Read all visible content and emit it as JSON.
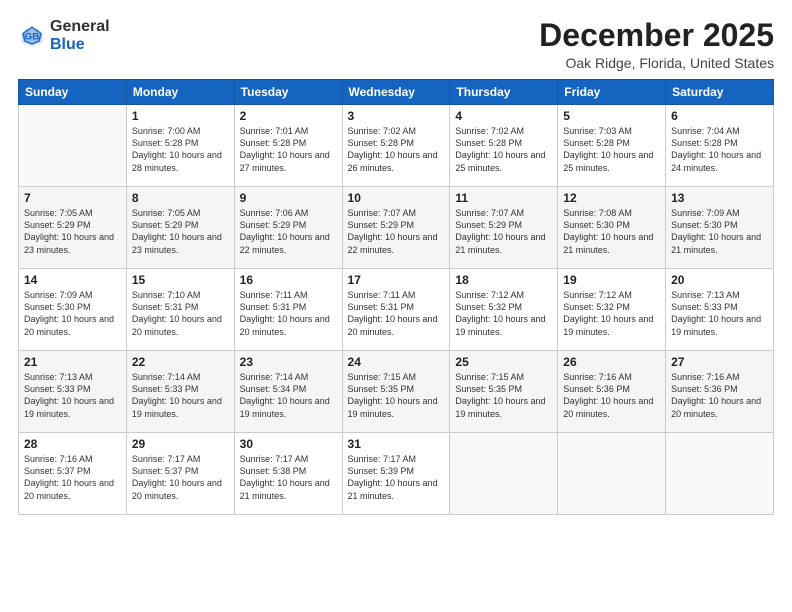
{
  "header": {
    "logo_general": "General",
    "logo_blue": "Blue",
    "month_title": "December 2025",
    "location": "Oak Ridge, Florida, United States"
  },
  "weekdays": [
    "Sunday",
    "Monday",
    "Tuesday",
    "Wednesday",
    "Thursday",
    "Friday",
    "Saturday"
  ],
  "weeks": [
    [
      {
        "day": "",
        "sunrise": "",
        "sunset": "",
        "daylight": ""
      },
      {
        "day": "1",
        "sunrise": "Sunrise: 7:00 AM",
        "sunset": "Sunset: 5:28 PM",
        "daylight": "Daylight: 10 hours and 28 minutes."
      },
      {
        "day": "2",
        "sunrise": "Sunrise: 7:01 AM",
        "sunset": "Sunset: 5:28 PM",
        "daylight": "Daylight: 10 hours and 27 minutes."
      },
      {
        "day": "3",
        "sunrise": "Sunrise: 7:02 AM",
        "sunset": "Sunset: 5:28 PM",
        "daylight": "Daylight: 10 hours and 26 minutes."
      },
      {
        "day": "4",
        "sunrise": "Sunrise: 7:02 AM",
        "sunset": "Sunset: 5:28 PM",
        "daylight": "Daylight: 10 hours and 25 minutes."
      },
      {
        "day": "5",
        "sunrise": "Sunrise: 7:03 AM",
        "sunset": "Sunset: 5:28 PM",
        "daylight": "Daylight: 10 hours and 25 minutes."
      },
      {
        "day": "6",
        "sunrise": "Sunrise: 7:04 AM",
        "sunset": "Sunset: 5:28 PM",
        "daylight": "Daylight: 10 hours and 24 minutes."
      }
    ],
    [
      {
        "day": "7",
        "sunrise": "Sunrise: 7:05 AM",
        "sunset": "Sunset: 5:29 PM",
        "daylight": "Daylight: 10 hours and 23 minutes."
      },
      {
        "day": "8",
        "sunrise": "Sunrise: 7:05 AM",
        "sunset": "Sunset: 5:29 PM",
        "daylight": "Daylight: 10 hours and 23 minutes."
      },
      {
        "day": "9",
        "sunrise": "Sunrise: 7:06 AM",
        "sunset": "Sunset: 5:29 PM",
        "daylight": "Daylight: 10 hours and 22 minutes."
      },
      {
        "day": "10",
        "sunrise": "Sunrise: 7:07 AM",
        "sunset": "Sunset: 5:29 PM",
        "daylight": "Daylight: 10 hours and 22 minutes."
      },
      {
        "day": "11",
        "sunrise": "Sunrise: 7:07 AM",
        "sunset": "Sunset: 5:29 PM",
        "daylight": "Daylight: 10 hours and 21 minutes."
      },
      {
        "day": "12",
        "sunrise": "Sunrise: 7:08 AM",
        "sunset": "Sunset: 5:30 PM",
        "daylight": "Daylight: 10 hours and 21 minutes."
      },
      {
        "day": "13",
        "sunrise": "Sunrise: 7:09 AM",
        "sunset": "Sunset: 5:30 PM",
        "daylight": "Daylight: 10 hours and 21 minutes."
      }
    ],
    [
      {
        "day": "14",
        "sunrise": "Sunrise: 7:09 AM",
        "sunset": "Sunset: 5:30 PM",
        "daylight": "Daylight: 10 hours and 20 minutes."
      },
      {
        "day": "15",
        "sunrise": "Sunrise: 7:10 AM",
        "sunset": "Sunset: 5:31 PM",
        "daylight": "Daylight: 10 hours and 20 minutes."
      },
      {
        "day": "16",
        "sunrise": "Sunrise: 7:11 AM",
        "sunset": "Sunset: 5:31 PM",
        "daylight": "Daylight: 10 hours and 20 minutes."
      },
      {
        "day": "17",
        "sunrise": "Sunrise: 7:11 AM",
        "sunset": "Sunset: 5:31 PM",
        "daylight": "Daylight: 10 hours and 20 minutes."
      },
      {
        "day": "18",
        "sunrise": "Sunrise: 7:12 AM",
        "sunset": "Sunset: 5:32 PM",
        "daylight": "Daylight: 10 hours and 19 minutes."
      },
      {
        "day": "19",
        "sunrise": "Sunrise: 7:12 AM",
        "sunset": "Sunset: 5:32 PM",
        "daylight": "Daylight: 10 hours and 19 minutes."
      },
      {
        "day": "20",
        "sunrise": "Sunrise: 7:13 AM",
        "sunset": "Sunset: 5:33 PM",
        "daylight": "Daylight: 10 hours and 19 minutes."
      }
    ],
    [
      {
        "day": "21",
        "sunrise": "Sunrise: 7:13 AM",
        "sunset": "Sunset: 5:33 PM",
        "daylight": "Daylight: 10 hours and 19 minutes."
      },
      {
        "day": "22",
        "sunrise": "Sunrise: 7:14 AM",
        "sunset": "Sunset: 5:33 PM",
        "daylight": "Daylight: 10 hours and 19 minutes."
      },
      {
        "day": "23",
        "sunrise": "Sunrise: 7:14 AM",
        "sunset": "Sunset: 5:34 PM",
        "daylight": "Daylight: 10 hours and 19 minutes."
      },
      {
        "day": "24",
        "sunrise": "Sunrise: 7:15 AM",
        "sunset": "Sunset: 5:35 PM",
        "daylight": "Daylight: 10 hours and 19 minutes."
      },
      {
        "day": "25",
        "sunrise": "Sunrise: 7:15 AM",
        "sunset": "Sunset: 5:35 PM",
        "daylight": "Daylight: 10 hours and 19 minutes."
      },
      {
        "day": "26",
        "sunrise": "Sunrise: 7:16 AM",
        "sunset": "Sunset: 5:36 PM",
        "daylight": "Daylight: 10 hours and 20 minutes."
      },
      {
        "day": "27",
        "sunrise": "Sunrise: 7:16 AM",
        "sunset": "Sunset: 5:36 PM",
        "daylight": "Daylight: 10 hours and 20 minutes."
      }
    ],
    [
      {
        "day": "28",
        "sunrise": "Sunrise: 7:16 AM",
        "sunset": "Sunset: 5:37 PM",
        "daylight": "Daylight: 10 hours and 20 minutes."
      },
      {
        "day": "29",
        "sunrise": "Sunrise: 7:17 AM",
        "sunset": "Sunset: 5:37 PM",
        "daylight": "Daylight: 10 hours and 20 minutes."
      },
      {
        "day": "30",
        "sunrise": "Sunrise: 7:17 AM",
        "sunset": "Sunset: 5:38 PM",
        "daylight": "Daylight: 10 hours and 21 minutes."
      },
      {
        "day": "31",
        "sunrise": "Sunrise: 7:17 AM",
        "sunset": "Sunset: 5:39 PM",
        "daylight": "Daylight: 10 hours and 21 minutes."
      },
      {
        "day": "",
        "sunrise": "",
        "sunset": "",
        "daylight": ""
      },
      {
        "day": "",
        "sunrise": "",
        "sunset": "",
        "daylight": ""
      },
      {
        "day": "",
        "sunrise": "",
        "sunset": "",
        "daylight": ""
      }
    ]
  ]
}
